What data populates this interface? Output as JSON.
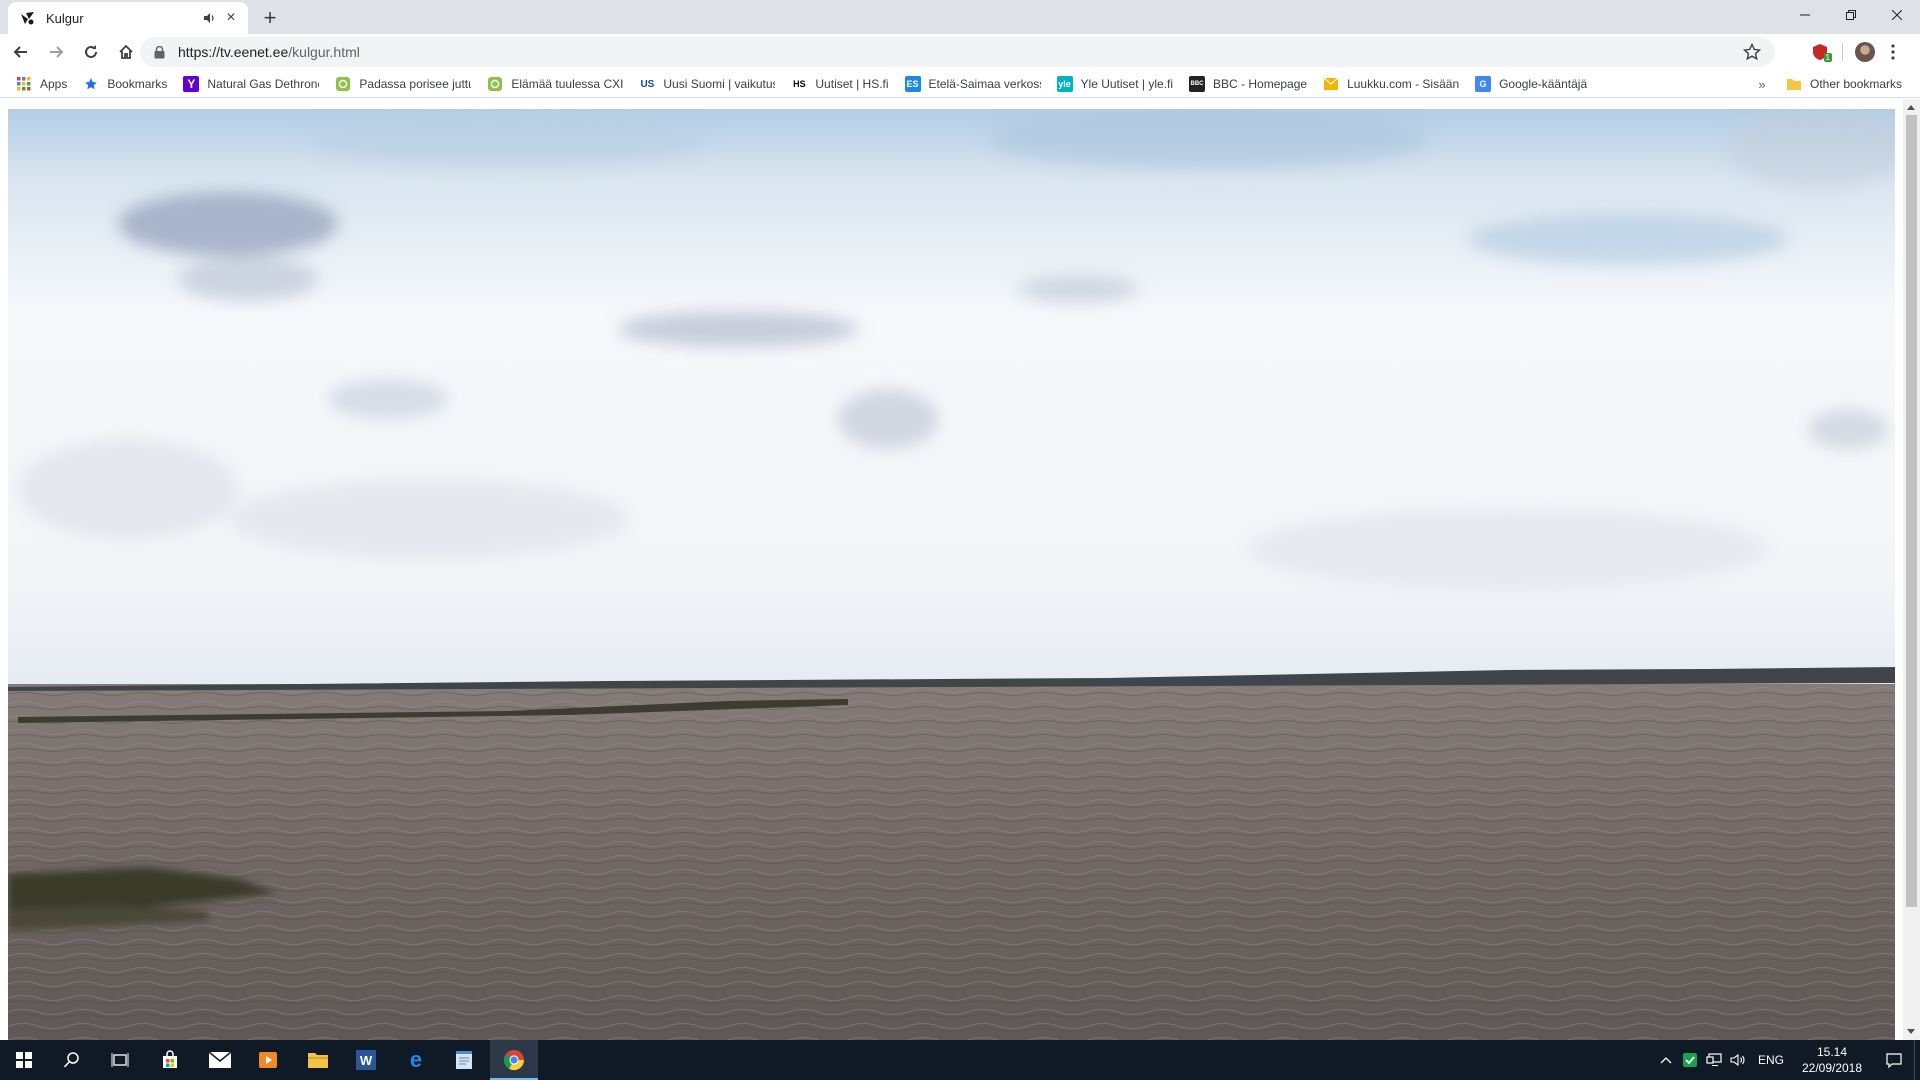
{
  "window": {
    "title": "Kulgur"
  },
  "tab": {
    "title": "Kulgur",
    "audio_playing": true
  },
  "toolbar": {
    "url_host": "https://tv.eenet.ee",
    "url_path": "/kulgur.html",
    "extension_badge": "1"
  },
  "bookmarks": {
    "items": [
      {
        "label": "Apps",
        "icon": "apps-grid-icon",
        "color": "#e84235"
      },
      {
        "label": "Bookmarks",
        "icon": "star-icon",
        "color": "#1a73e8"
      },
      {
        "label": "Natural Gas Dethrone",
        "icon": "yahoo-icon",
        "color": "#5f01d1"
      },
      {
        "label": "Padassa porisee juttu",
        "icon": "green-circle-icon",
        "color": "#8bc34a"
      },
      {
        "label": "Elämää tuulessa CXIII",
        "icon": "green-circle-icon",
        "color": "#8bc34a"
      },
      {
        "label": "Uusi Suomi | vaikutus",
        "icon": "us-icon",
        "color": "#0d47a1",
        "icon_text": "US"
      },
      {
        "label": "Uutiset | HS.fi",
        "icon": "hs-icon",
        "color": "#000000",
        "icon_text": "HS"
      },
      {
        "label": "Etelä-Saimaa verkoss",
        "icon": "es-icon",
        "color": "#1e88e5",
        "icon_text": "ES"
      },
      {
        "label": "Yle Uutiset | yle.fi",
        "icon": "yle-icon",
        "color": "#00b4c8",
        "icon_text": "yle"
      },
      {
        "label": "BBC - Homepage",
        "icon": "bbc-icon",
        "color": "#222222",
        "icon_text": "BBC"
      },
      {
        "label": "Luukku.com - Sisäänk",
        "icon": "mail-envelope-icon",
        "color": "#f2b600"
      },
      {
        "label": "Google-kääntäjä",
        "icon": "google-translate-icon",
        "color": "#4285f4",
        "icon_text": "G"
      }
    ],
    "more": "»",
    "other_label": "Other bookmarks"
  },
  "taskbar": {
    "apps": [
      "start-icon",
      "search-icon",
      "task-view-icon",
      "store-icon",
      "mail-icon",
      "media-player-icon",
      "file-explorer-icon",
      "word-icon",
      "edge-icon",
      "notepad-icon",
      "chrome-icon"
    ],
    "active_app": "chrome-icon",
    "language": "ENG",
    "time": "15.14",
    "date": "22/09/2018"
  },
  "colors": {
    "tabstrip": "#dee1e6",
    "taskbar": "#101a26",
    "sky": "#eaf1f7",
    "sea": "#6f6766"
  }
}
